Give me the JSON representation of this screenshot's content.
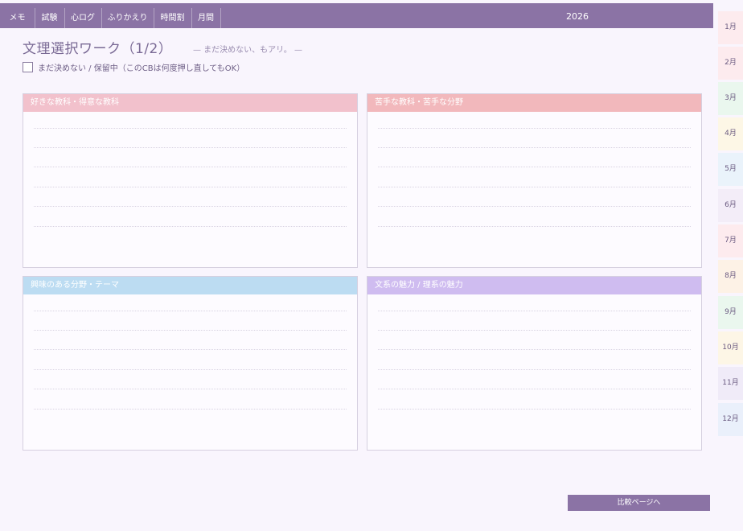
{
  "nav": {
    "tabs": [
      {
        "label": "メモ"
      },
      {
        "label": "試験"
      },
      {
        "label": "心ログ"
      },
      {
        "label": "ふりかえり"
      },
      {
        "label": "時間割"
      },
      {
        "label": "月間"
      }
    ],
    "year": "2026"
  },
  "months": [
    {
      "label": "1月",
      "color": "#fdebee"
    },
    {
      "label": "2月",
      "color": "#fdebee"
    },
    {
      "label": "3月",
      "color": "#eaf7ee"
    },
    {
      "label": "4月",
      "color": "#fdf7e6"
    },
    {
      "label": "5月",
      "color": "#eaf3fb"
    },
    {
      "label": "6月",
      "color": "#f3edf8"
    },
    {
      "label": "7月",
      "color": "#fdebee"
    },
    {
      "label": "8月",
      "color": "#fdf2e6"
    },
    {
      "label": "9月",
      "color": "#eaf7ee"
    },
    {
      "label": "10月",
      "color": "#fdf6e6"
    },
    {
      "label": "11月",
      "color": "#f0ebf8"
    },
    {
      "label": "12月",
      "color": "#eaf0fb"
    }
  ],
  "page": {
    "title": "文理選択ワーク（1/2）",
    "subnote": "— まだ決めない、もアリ。 —",
    "checkbox_label": "まだ決めない / 保留中（このCBは何度押し直してもOK）",
    "checkbox_checked": false
  },
  "panels": [
    {
      "title": "好きな教科・得意な教科",
      "color": "#f2c1cc"
    },
    {
      "title": "苦手な教科・苦手な分野",
      "color": "#f2b8bc"
    },
    {
      "title": "興味のある分野・テーマ",
      "color": "#bcdcf2"
    },
    {
      "title": "文系の魅力 / 理系の魅力",
      "color": "#cfbcf0"
    }
  ],
  "footer": {
    "next_label": "比較ページへ"
  }
}
